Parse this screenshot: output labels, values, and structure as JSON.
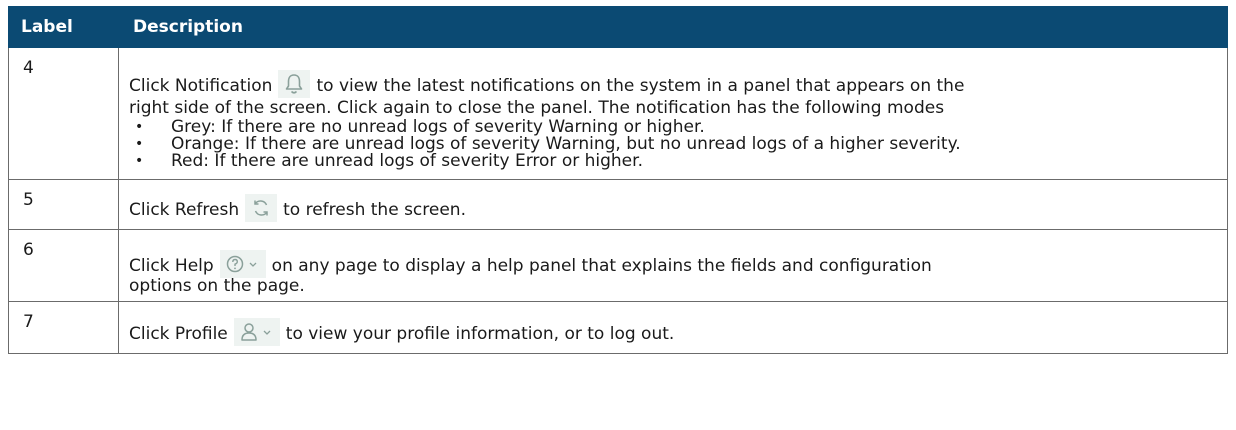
{
  "header": {
    "label": "Label",
    "description": "Description"
  },
  "rows": [
    {
      "label": "4",
      "pre": "Click Notification",
      "icon": "bell-icon",
      "post": "to view the latest notifications on the system in a panel that appears on the",
      "line2": "right side of the screen. Click again to close the panel. The notification has the following modes",
      "bullets": [
        "Grey: If there are no unread logs of severity Warning or higher.",
        "Orange: If there are unread logs of severity Warning, but no unread logs of a higher severity.",
        "Red: If there are unread logs of severity Error or higher."
      ]
    },
    {
      "label": "5",
      "pre": "Click Refresh",
      "icon": "refresh-icon",
      "post": "to refresh the screen."
    },
    {
      "label": "6",
      "pre": "Click Help",
      "icon": "help-dropdown-icon",
      "post": "on any page to display a help panel that explains the fields and configuration",
      "line2": "options on the page."
    },
    {
      "label": "7",
      "pre": "Click Profile",
      "icon": "profile-dropdown-icon",
      "post": "to view your profile information, or to log out."
    }
  ],
  "colors": {
    "header_bg": "#0b4a73",
    "icon_bg": "#eef3f1",
    "icon_stroke": "#8aa09a"
  }
}
